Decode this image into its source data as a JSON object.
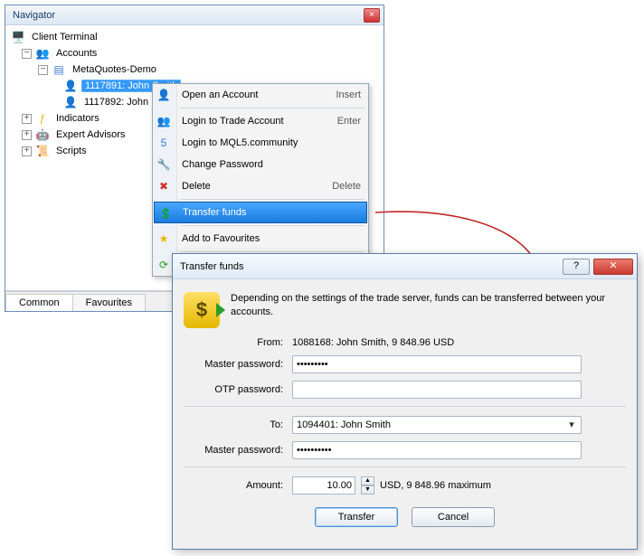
{
  "navigator": {
    "title": "Navigator",
    "root": "Client Terminal",
    "nodes": {
      "accounts": "Accounts",
      "demo": "MetaQuotes-Demo",
      "acc1": "1117891: John Smith",
      "acc2": "1117892: John Smith",
      "indicators": "Indicators",
      "experts": "Expert Advisors",
      "scripts": "Scripts"
    },
    "tabs": {
      "common": "Common",
      "favourites": "Favourites"
    }
  },
  "menu": {
    "open": "Open an Account",
    "open_sc": "Insert",
    "login_trade": "Login to Trade Account",
    "login_trade_sc": "Enter",
    "login_mql5": "Login to MQL5.community",
    "change_pw": "Change Password",
    "delete": "Delete",
    "delete_sc": "Delete",
    "transfer": "Transfer funds",
    "fav": "Add to Favourites"
  },
  "dialog": {
    "title": "Transfer funds",
    "description": "Depending on the settings of the trade server, funds can be transferred between your accounts.",
    "from_label": "From:",
    "from_value": "1088168: John Smith, 9 848.96 USD",
    "master_pw_label": "Master password:",
    "master_pw_value": "•••••••••",
    "otp_label": "OTP password:",
    "otp_value": "",
    "to_label": "To:",
    "to_value": "1094401: John Smith",
    "master_pw2_value": "••••••••••",
    "amount_label": "Amount:",
    "amount_value": "10.00",
    "amount_suffix": "USD, 9 848.96 maximum",
    "transfer_btn": "Transfer",
    "cancel_btn": "Cancel"
  }
}
